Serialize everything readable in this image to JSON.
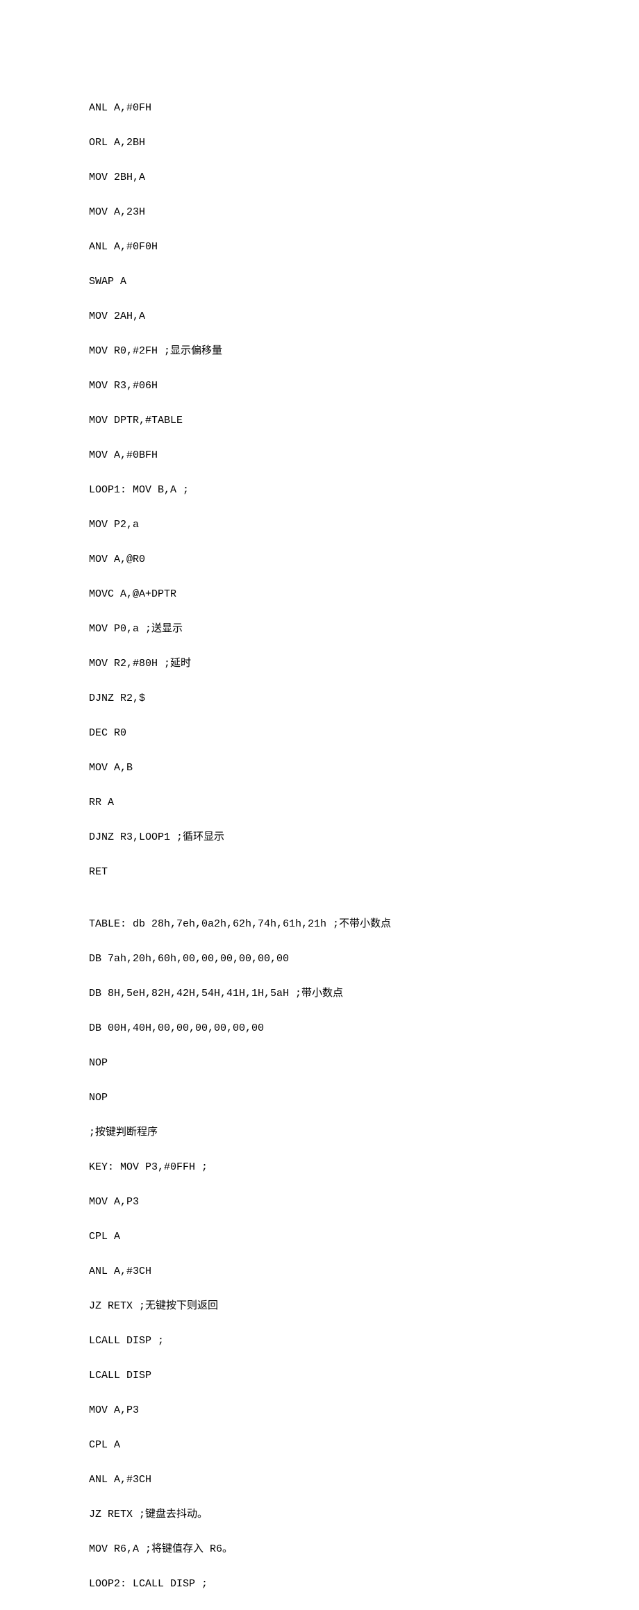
{
  "lines": [
    "ANL A,#0FH",
    "ORL A,2BH",
    "MOV 2BH,A",
    "MOV A,23H",
    "ANL A,#0F0H",
    "SWAP A",
    "MOV 2AH,A",
    "MOV R0,#2FH ;显示偏移量",
    "MOV R3,#06H",
    "MOV DPTR,#TABLE",
    "MOV A,#0BFH",
    "LOOP1: MOV B,A ;",
    "MOV P2,a",
    "MOV A,@R0",
    "MOVC A,@A+DPTR",
    "MOV P0,a ;送显示",
    "MOV R2,#80H ;延时",
    "DJNZ R2,$",
    "DEC R0",
    "MOV A,B",
    "RR A",
    "DJNZ R3,LOOP1 ;循环显示",
    "RET",
    "",
    "TABLE: db 28h,7eh,0a2h,62h,74h,61h,21h ;不带小数点",
    "DB 7ah,20h,60h,00,00,00,00,00,00",
    "DB 8H,5eH,82H,42H,54H,41H,1H,5aH ;带小数点",
    "DB 00H,40H,00,00,00,00,00,00",
    "NOP",
    "NOP",
    ";按键判断程序",
    "KEY: MOV P3,#0FFH ;",
    "MOV A,P3",
    "CPL A",
    "ANL A,#3CH",
    "JZ RETX ;无键按下则返回",
    "LCALL DISP ;",
    "LCALL DISP",
    "MOV A,P3",
    "CPL A",
    "ANL A,#3CH",
    "JZ RETX ;键盘去抖动。",
    "MOV R6,A ;将键值存入 R6。",
    "LOOP2: LCALL DISP ;"
  ]
}
